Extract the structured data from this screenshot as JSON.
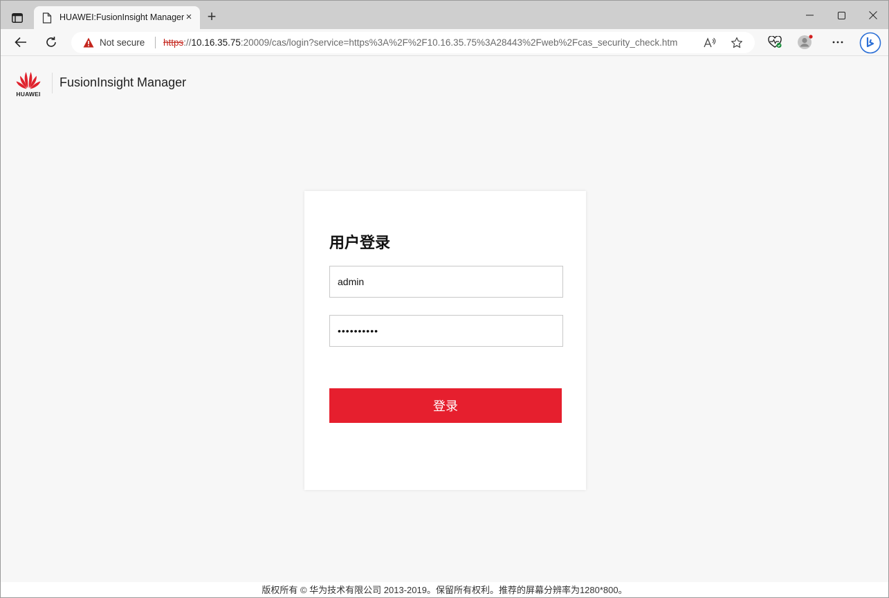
{
  "browser": {
    "tab_title": "HUAWEI:FusionInsight Manager",
    "tab_close": "×",
    "new_tab": "+",
    "security_label": "Not secure",
    "url_protocol": "https",
    "url_sep": "://",
    "url_host": "10.16.35.75",
    "url_rest": ":20009/cas/login?service=https%3A%2F%2F10.16.35.75%3A28443%2Fweb%2Fcas_security_check.htm",
    "colors": {
      "warning": "#c4261d",
      "brand": "#e61f2e"
    }
  },
  "header": {
    "logo_text": "HUAWEI",
    "app_title": "FusionInsight Manager"
  },
  "login": {
    "title": "用户登录",
    "username_value": "admin",
    "password_value": "••••••••••",
    "submit_label": "登录"
  },
  "footer": {
    "copyright": "版权所有 © 华为技术有限公司 2013-2019。保留所有权利。推荐的屏幕分辨率为1280*800。"
  }
}
